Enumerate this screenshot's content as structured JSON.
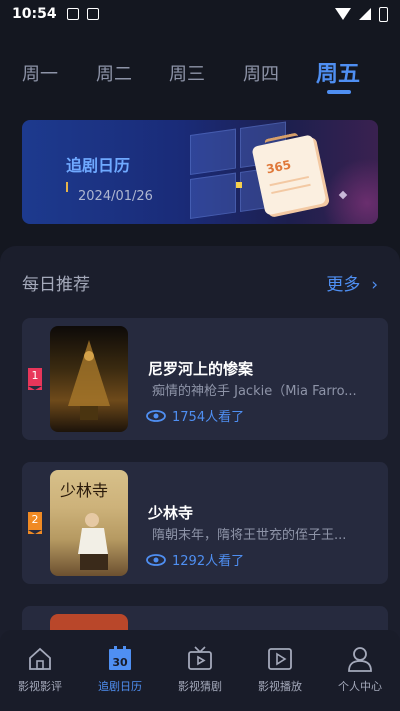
{
  "status_bar": {
    "time": "10:54"
  },
  "weekdays": {
    "tabs": [
      "周一",
      "周二",
      "周三",
      "周四",
      "周五"
    ],
    "active": "周五"
  },
  "banner": {
    "title": "追剧日历",
    "date": "2024/01/26",
    "calendar_number": "365"
  },
  "recommend": {
    "title": "每日推荐",
    "more_label": "更多",
    "items": [
      {
        "rank": "1",
        "title": "尼罗河上的惨案",
        "desc": "痴情的神枪手 Jackie（Mia Farro...",
        "views": "1754人看了"
      },
      {
        "rank": "2",
        "title": "少林寺",
        "desc": "隋朝末年，隋将王世充的侄子王...",
        "views": "1292人看了"
      }
    ]
  },
  "bottom_nav": {
    "items": [
      {
        "label": "影视影评",
        "icon": "home-icon"
      },
      {
        "label": "追剧日历",
        "icon": "calendar-icon"
      },
      {
        "label": "影视猜剧",
        "icon": "tv-icon"
      },
      {
        "label": "影视播放",
        "icon": "play-icon"
      },
      {
        "label": "个人中心",
        "icon": "person-icon"
      }
    ],
    "active": "追剧日历"
  },
  "colors": {
    "accent": "#4f8ff2",
    "background": "#141720",
    "card": "#262a3e",
    "rank1": "#e8365a",
    "rank2": "#f08a24"
  }
}
